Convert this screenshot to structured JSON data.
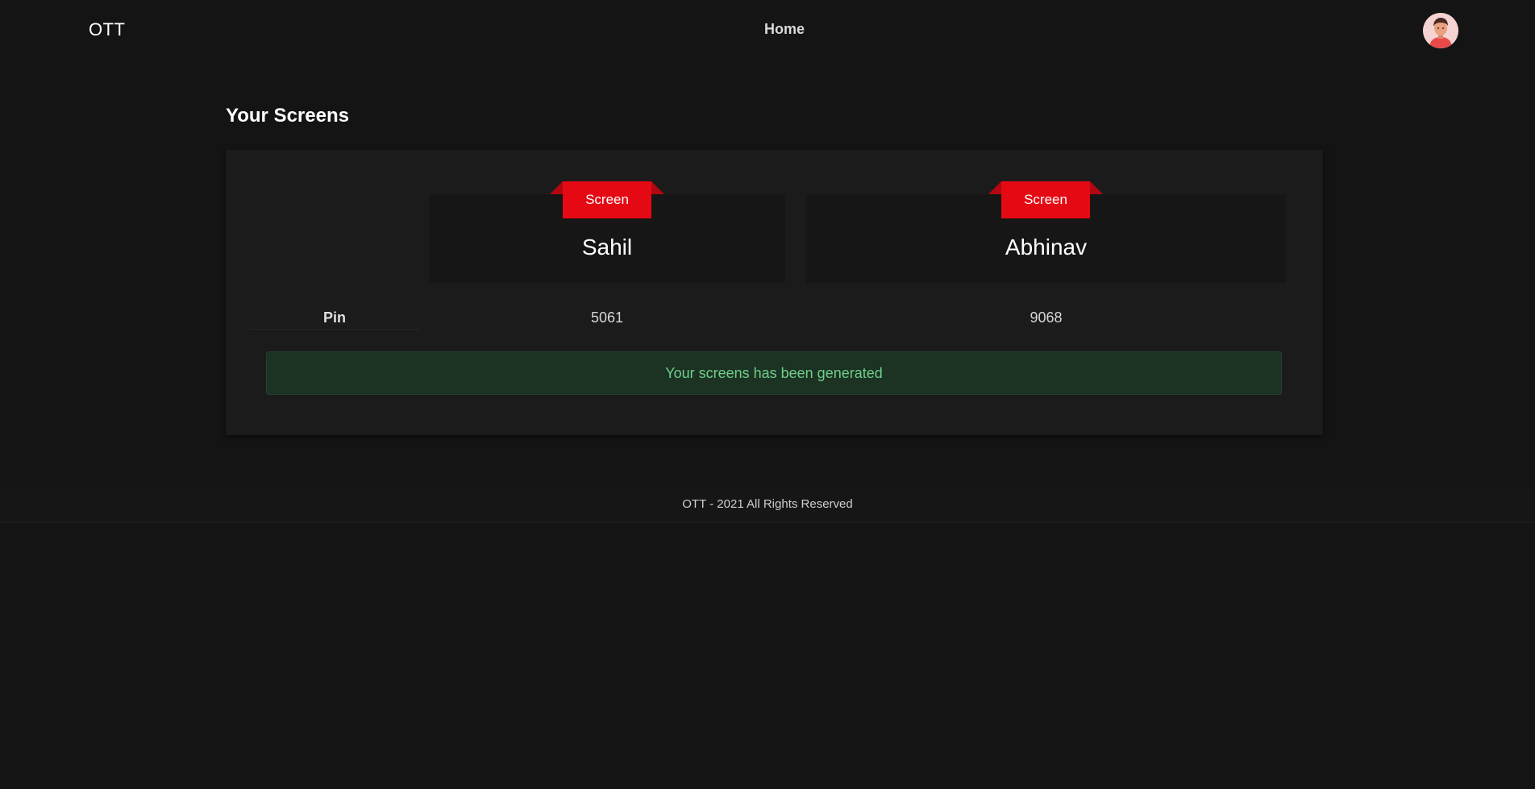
{
  "nav": {
    "brand": "OTT",
    "home_label": "Home",
    "avatar_icon": "user-avatar-icon"
  },
  "main": {
    "title": "Your Screens",
    "screens": [
      {
        "ribbon": "Screen",
        "name": "Sahil",
        "pin": "5061"
      },
      {
        "ribbon": "Screen",
        "name": "Abhinav",
        "pin": "9068"
      }
    ],
    "pin_label": "Pin",
    "alert_text": "Your screens has been generated"
  },
  "footer": {
    "text": "OTT - 2021 All Rights Reserved"
  },
  "colors": {
    "background": "#141414",
    "panel": "#1b1b1b",
    "accent": "#e50914",
    "alert_bg": "#1c3223",
    "alert_text": "#6fcf8a"
  }
}
